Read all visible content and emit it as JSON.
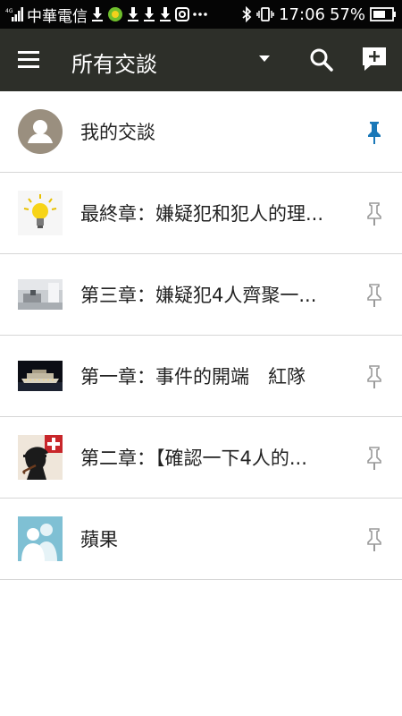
{
  "status_bar": {
    "carrier": "中華電信",
    "time": "17:06",
    "battery": "57%",
    "icons": [
      "signal-icon",
      "download-icon",
      "app-icon",
      "download-icon",
      "download-icon",
      "download-icon",
      "instagram-icon",
      "more-icon",
      "bluetooth-icon",
      "vibrate-icon",
      "battery-icon"
    ]
  },
  "toolbar": {
    "title": "所有交談",
    "icons": [
      "menu-icon",
      "dropdown-caret-icon",
      "search-icon",
      "new-conversation-icon"
    ]
  },
  "conversations": [
    {
      "title": "我的交談",
      "avatar": "default-person-avatar",
      "pinned": true
    },
    {
      "title": "最終章：嫌疑犯和犯人的理...",
      "avatar": "lightbulb-avatar",
      "pinned": false
    },
    {
      "title": "第三章：嫌疑犯4人齊聚一...",
      "avatar": "room-photo-avatar",
      "pinned": false
    },
    {
      "title": "第一章：事件的開端　紅隊",
      "avatar": "ship-photo-avatar",
      "pinned": false
    },
    {
      "title": "第二章：【確認一下4人的...",
      "avatar": "detective-avatar",
      "pinned": false
    },
    {
      "title": "蘋果",
      "avatar": "group-avatar",
      "pinned": false
    }
  ],
  "colors": {
    "status_bar_bg": "#050505",
    "toolbar_bg": "#2d2f29",
    "pin_active": "#1a78b8",
    "pin_inactive": "#9a9a9a",
    "divider": "#d6d6d6"
  }
}
